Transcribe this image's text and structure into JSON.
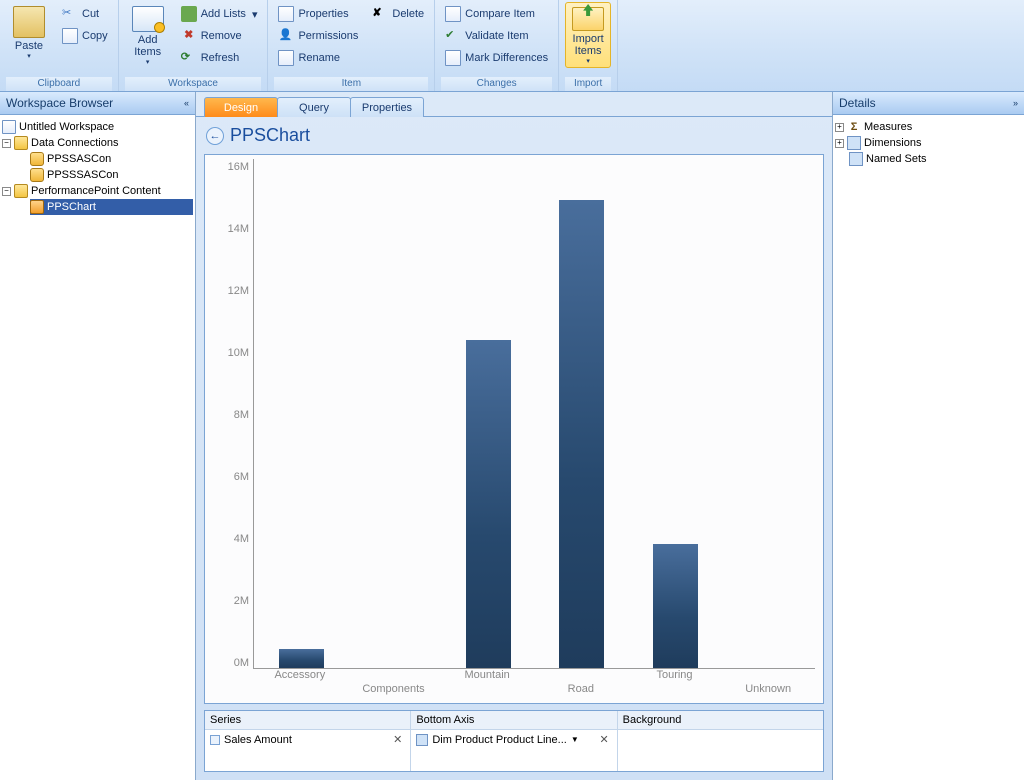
{
  "ribbon": {
    "clipboard": {
      "label": "Clipboard",
      "paste": "Paste",
      "cut": "Cut",
      "copy": "Copy"
    },
    "workspace": {
      "label": "Workspace",
      "add_items": "Add\nItems",
      "add_lists": "Add Lists",
      "remove": "Remove",
      "refresh": "Refresh"
    },
    "item": {
      "label": "Item",
      "properties": "Properties",
      "permissions": "Permissions",
      "rename": "Rename",
      "delete": "Delete"
    },
    "changes": {
      "label": "Changes",
      "compare": "Compare Item",
      "validate": "Validate Item",
      "mark": "Mark Differences"
    },
    "import": {
      "label": "Import",
      "import_items": "Import\nItems"
    }
  },
  "workspace_browser": {
    "title": "Workspace Browser",
    "root": "Untitled Workspace",
    "data_connections": "Data Connections",
    "conn1": "PPSSASCon",
    "conn2": "PPSSSASCon",
    "pp_content": "PerformancePoint Content",
    "chart_item": "PPSChart"
  },
  "center": {
    "tabs": {
      "design": "Design",
      "query": "Query",
      "properties": "Properties"
    },
    "title": "PPSChart",
    "config": {
      "series_hd": "Series",
      "series_item": "Sales Amount",
      "axis_hd": "Bottom Axis",
      "axis_item": "Dim Product Product Line...",
      "bg_hd": "Background"
    }
  },
  "details": {
    "title": "Details",
    "measures": "Measures",
    "dimensions": "Dimensions",
    "named_sets": "Named Sets"
  },
  "chart_data": {
    "type": "bar",
    "title": "",
    "xlabel": "",
    "ylabel": "",
    "ylim": [
      0,
      16000000
    ],
    "y_ticks": [
      "16M",
      "14M",
      "12M",
      "10M",
      "8M",
      "6M",
      "4M",
      "2M",
      "0M"
    ],
    "categories": [
      "Accessory",
      "Components",
      "Mountain",
      "Road",
      "Touring",
      "Unknown"
    ],
    "values": [
      600000,
      0,
      10300000,
      14700000,
      3900000,
      0
    ]
  }
}
